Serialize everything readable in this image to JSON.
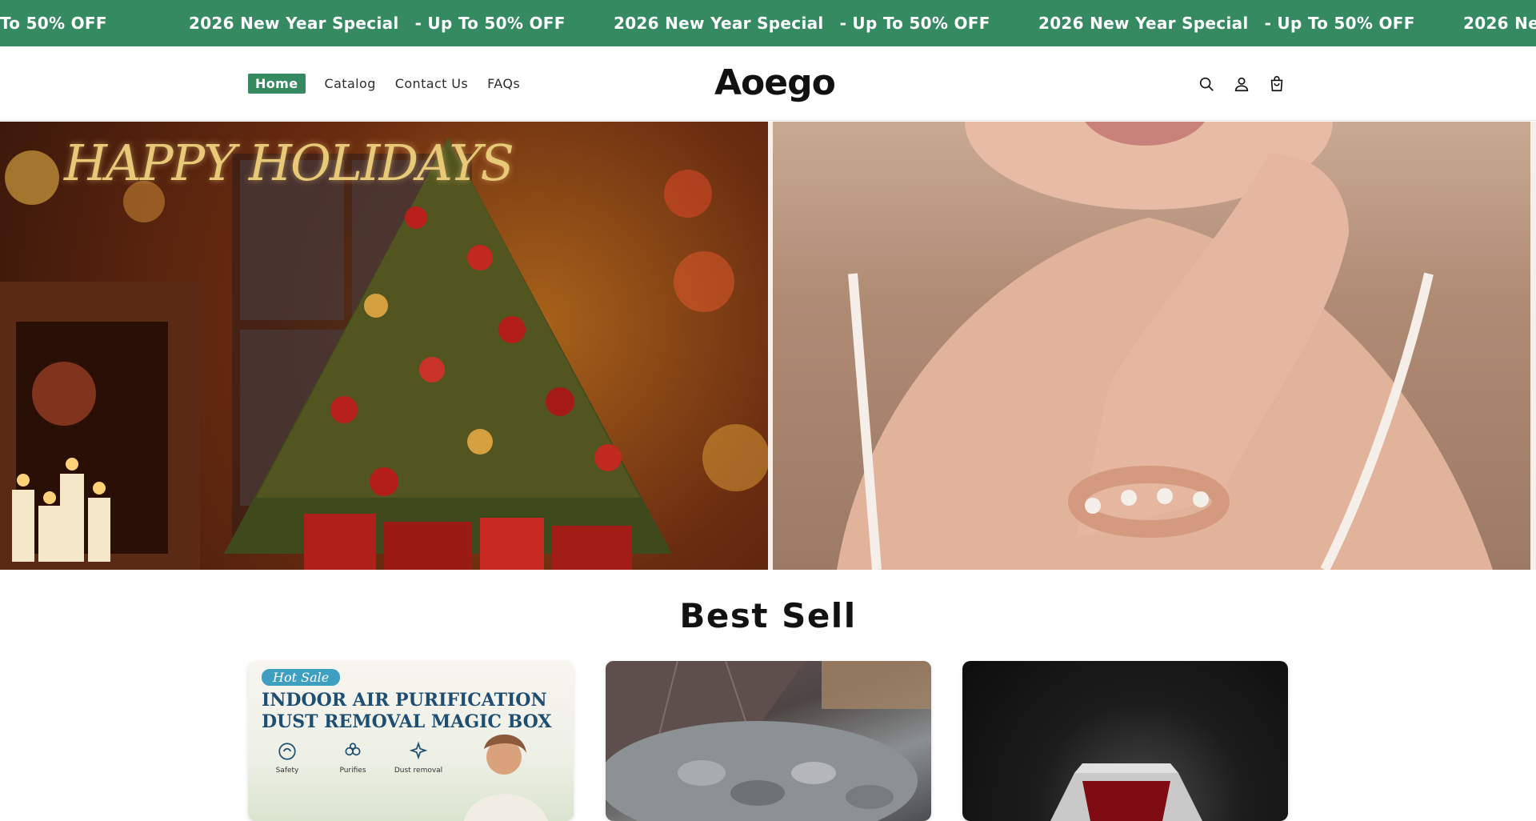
{
  "announcement": {
    "segments": [
      {
        "title": "",
        "offer": "To 50% OFF"
      },
      {
        "title": "2026 New Year Special",
        "offer": "- Up To 50% OFF"
      },
      {
        "title": "2026 New Year Special",
        "offer": "- Up To 50% OFF"
      },
      {
        "title": "2026 New Year Special",
        "offer": "- Up To 50% OFF"
      },
      {
        "title": "2026 New",
        "offer": ""
      }
    ]
  },
  "nav": {
    "items": [
      {
        "label": "Home",
        "active": true
      },
      {
        "label": "Catalog"
      },
      {
        "label": "Contact Us"
      },
      {
        "label": "FAQs"
      }
    ]
  },
  "brand": {
    "logo": "Aoego"
  },
  "header_icons": [
    "search-icon",
    "account-icon",
    "cart-icon"
  ],
  "hero": {
    "slides": [
      {
        "overlay_text": "HAPPY HOLIDAYS"
      },
      {
        "overlay_text": ""
      }
    ]
  },
  "best_sell": {
    "title": "Best Sell",
    "products": [
      {
        "badge": "Hot Sale",
        "headline_line1": "INDOOR AIR PURIFICATION",
        "headline_line2": "DUST REMOVAL MAGIC BOX",
        "features": [
          "Safety",
          "Purifies",
          "Dust removal"
        ]
      },
      {},
      {}
    ]
  },
  "colors": {
    "accent": "#358a62",
    "badge_blue": "#3f9fc0",
    "headline_blue": "#1e4f73"
  }
}
